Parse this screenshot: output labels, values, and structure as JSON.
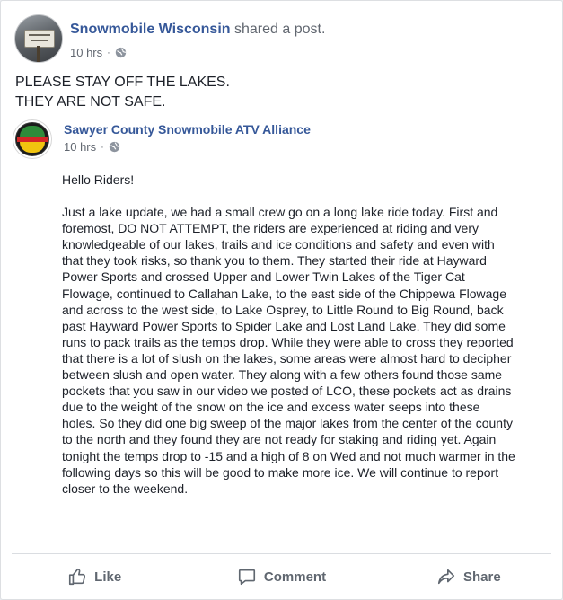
{
  "post": {
    "author": "Snowmobile Wisconsin",
    "action": "shared a post.",
    "time": "10 hrs",
    "separator": "·",
    "headline": [
      "PLEASE STAY OFF THE LAKES.",
      "THEY ARE NOT SAFE."
    ]
  },
  "shared": {
    "author": "Sawyer County Snowmobile ATV Alliance",
    "time": "10 hrs",
    "separator": "·",
    "greeting": "Hello Riders!",
    "lines": [
      "Just a lake update, we had a small crew go on a long lake ride today. First and",
      "foremost, DO NOT ATTEMPT, the riders are experienced at riding and very",
      "knowledgeable of our lakes, trails and ice conditions and safety and even with",
      "that they took risks, so thank you to them. They started their ride at Hayward",
      "Power Sports and crossed Upper and Lower Twin Lakes of the Tiger Cat",
      "Flowage, continued to Callahan Lake, to the east side of the Chippewa Flowage",
      "and across to the west side, to Lake Osprey, to Little Round to Big Round, back",
      "past Hayward Power Sports to Spider Lake and Lost Land Lake. They did some",
      "runs to pack trails as the temps drop. While they were able to cross they reported",
      "that there is a lot of slush on the lakes, some areas were almost hard to decipher",
      "between slush and open water. They along with a few others found those same",
      "pockets that you saw in our video we posted of LCO, these pockets act as drains",
      "due to the weight of the snow on the ice and excess water seeps into these",
      "holes. So they did one big sweep of the major lakes from the center of the county",
      "to the north and they found they are not ready for staking and riding yet. Again",
      "tonight the temps drop to -15 and a high of 8 on Wed and not much warmer in the",
      "following days so this will be good to make more ice. We will continue to report",
      "closer to the weekend."
    ]
  },
  "actions": {
    "like": "Like",
    "comment": "Comment",
    "share": "Share"
  },
  "icons": {
    "privacy": "globe-icon",
    "like": "thumbs-up-icon",
    "comment": "speech-bubble-icon",
    "share": "share-arrow-icon"
  },
  "colors": {
    "link": "#365899",
    "text": "#1d2129",
    "muted": "#616770",
    "background": "#e9ebee"
  }
}
